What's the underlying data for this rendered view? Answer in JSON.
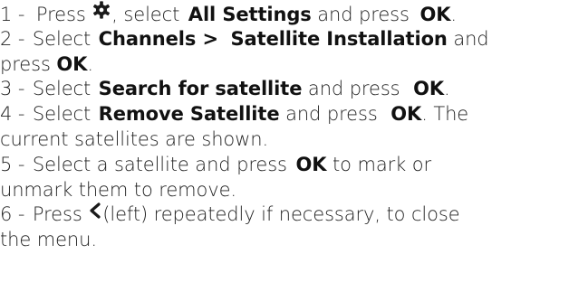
{
  "steps": [
    {
      "number": "1 -",
      "p1": "Press",
      "p2": ", select",
      "settings": "All Settings",
      "p3": "and press",
      "ok": "OK",
      "p4": "."
    },
    {
      "number": "2 -",
      "p1": "Select",
      "channels": "Channels >",
      "satellite_installation": "Satellite Installation",
      "p2": "and",
      "p3": "press",
      "ok": "OK",
      "p4": "."
    },
    {
      "number": "3 -",
      "p1": "Select",
      "item": "Search for satellite",
      "p2": "and press",
      "ok": "OK",
      "p3": "."
    },
    {
      "number": "4 -",
      "p1": "Select",
      "item": "Remove Satellite",
      "p2": "and press",
      "ok": "OK",
      "p3": ". The",
      "p4": "current satellites are shown."
    },
    {
      "number": "5 -",
      "p1": "Select a satellite and press",
      "ok": "OK",
      "p2": "to mark or",
      "p3": "unmark them to remove."
    },
    {
      "number": "6 -",
      "p1": "Press",
      "p2": "(left) repeatedly if necessary, to close",
      "p3": "the menu."
    }
  ],
  "icons": {
    "settings": "gear-icon",
    "left": "chevron-left-icon"
  },
  "colors": {
    "text": "#222222",
    "bold": "#111111"
  }
}
